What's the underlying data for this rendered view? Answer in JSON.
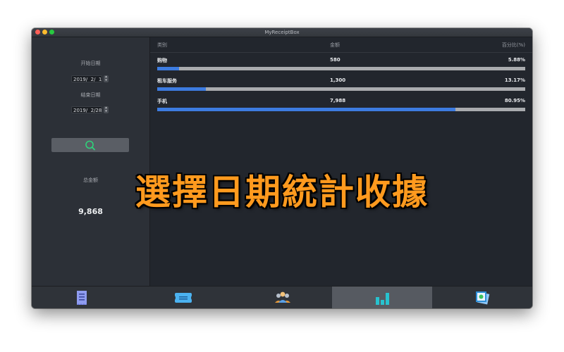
{
  "window": {
    "title": "MyReceiptBox"
  },
  "sidebar": {
    "start_label": "开始日期",
    "start_date": "2019/  2/  1",
    "end_label": "结束日期",
    "end_date": "2019/  2/28",
    "total_label": "总金额",
    "total_value": "9,868"
  },
  "table": {
    "headers": {
      "category": "类别",
      "amount": "金额",
      "percent": "百分比(%)"
    },
    "rows": [
      {
        "category": "购物",
        "amount": "580",
        "percent": "5.88%",
        "fraction": 0.0588
      },
      {
        "category": "租车服务",
        "amount": "1,300",
        "percent": "13.17%",
        "fraction": 0.1317
      },
      {
        "category": "手机",
        "amount": "7,988",
        "percent": "80.95%",
        "fraction": 0.8095
      }
    ]
  },
  "overlay": {
    "caption": "選擇日期統計收據"
  },
  "tabs": [
    {
      "icon": "receipt-icon",
      "active": false
    },
    {
      "icon": "ticket-icon",
      "active": false
    },
    {
      "icon": "people-icon",
      "active": false
    },
    {
      "icon": "bar-chart-icon",
      "active": true
    },
    {
      "icon": "photo-icon",
      "active": false
    }
  ],
  "colors": {
    "accent": "#3d7ce0",
    "overlay": "#ff9a1e",
    "search_icon": "#2fd27a"
  }
}
